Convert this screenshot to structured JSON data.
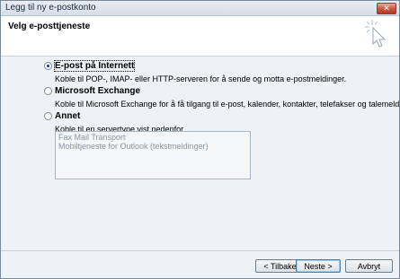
{
  "window": {
    "title": "Legg til ny e-postkonto",
    "close_glyph": "✕"
  },
  "header": {
    "title": "Velg e-posttjeneste",
    "icon": "cursor-sparkle-icon"
  },
  "options": [
    {
      "label": "E-post på Internett",
      "description": "Koble til POP-, IMAP- eller HTTP-serveren for å sende og motta e-postmeldinger.",
      "selected": true
    },
    {
      "label": "Microsoft Exchange",
      "description": "Koble til Microsoft Exchange for å få tilgang til e-post, kalender, kontakter, telefakser og talemeldinger.",
      "selected": false
    },
    {
      "label": "Annet",
      "description": "Koble til en servertype vist nedenfor.",
      "selected": false
    }
  ],
  "other_services": [
    "Fax Mail Transport",
    "Mobiltjeneste for Outlook (tekstmeldinger)"
  ],
  "buttons": {
    "back": "< Tilbake",
    "next": "Neste >",
    "cancel": "Avbryt"
  }
}
